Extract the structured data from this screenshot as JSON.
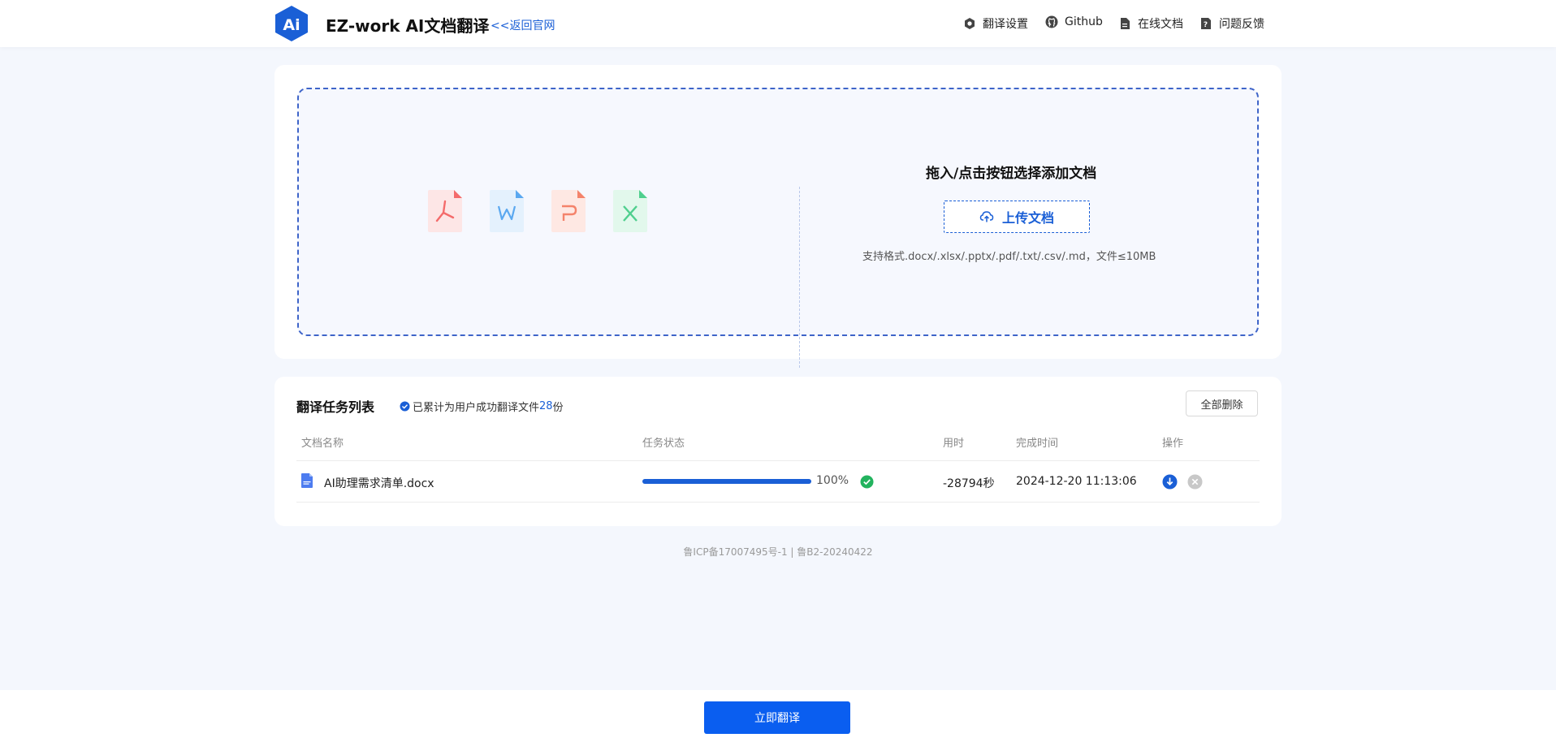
{
  "header": {
    "logo_text": "Ai",
    "title": "EZ-work AI文档翻译",
    "back_link": "<<返回官网",
    "nav": [
      {
        "label": "翻译设置",
        "icon": "gear-icon"
      },
      {
        "label": "Github",
        "icon": "github-icon"
      },
      {
        "label": "在线文档",
        "icon": "document-icon"
      },
      {
        "label": "问题反馈",
        "icon": "feedback-icon"
      }
    ]
  },
  "upload": {
    "title": "拖入/点击按钮选择添加文档",
    "button_label": "上传文档",
    "formats": "支持格式.docx/.xlsx/.pptx/.pdf/.txt/.csv/.md，文件≤10MB",
    "file_types": [
      {
        "name": "pdf-file-icon",
        "color": "#f46b6b"
      },
      {
        "name": "word-file-icon",
        "color": "#5aa8f0"
      },
      {
        "name": "ppt-file-icon",
        "color": "#f4836b"
      },
      {
        "name": "excel-file-icon",
        "color": "#4fcf8e"
      }
    ]
  },
  "tasks": {
    "title": "翻译任务列表",
    "count_prefix": "已累计为用户成功翻译文件",
    "count": "28",
    "count_suffix": "份",
    "delete_all": "全部删除",
    "columns": [
      "文档名称",
      "任务状态",
      "用时",
      "完成时间",
      "操作"
    ],
    "rows": [
      {
        "file_name": "AI助理需求清单.docx",
        "progress": 100,
        "progress_text": "100%",
        "duration": "-28794秒",
        "completed_at": "2024-12-20 11:13:06"
      }
    ]
  },
  "footer": {
    "icp": "鲁ICP备17007495号-1 | 鲁B2-20240422"
  },
  "actions": {
    "translate_now": "立即翻译"
  },
  "colors": {
    "primary": "#1a5fd6",
    "success": "#22b35e",
    "page_bg": "#f4f7fd"
  }
}
